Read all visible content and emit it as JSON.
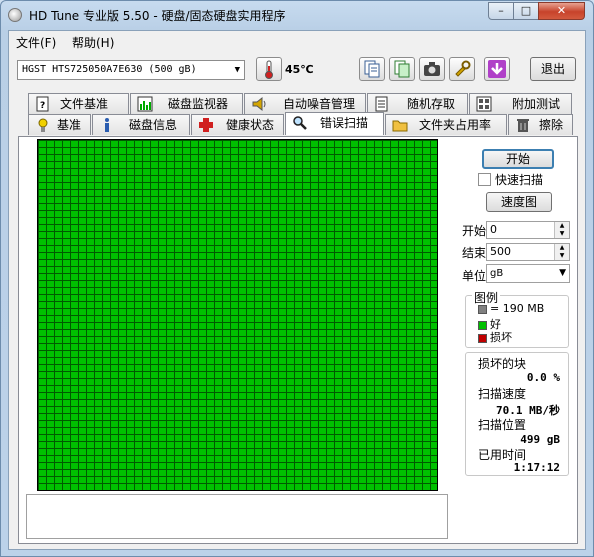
{
  "window": {
    "title": "HD Tune 专业版 5.50 - 硬盘/固态硬盘实用程序",
    "min": "–",
    "max": "□",
    "close": "✕"
  },
  "menu": {
    "file": "文件(F)",
    "help": "帮助(H)"
  },
  "toolbar": {
    "drive": "HGST   HTS725050A7E630  (500 gB)",
    "temperature": "45℃",
    "exit": "退出"
  },
  "tabs_row1": [
    {
      "label": "文件基准",
      "icon": "file-benchmark-icon"
    },
    {
      "label": "磁盘监视器",
      "icon": "disk-monitor-icon"
    },
    {
      "label": "自动噪音管理",
      "icon": "speaker-icon"
    },
    {
      "label": "随机存取",
      "icon": "random-access-icon"
    },
    {
      "label": "附加测试",
      "icon": "extra-tests-icon"
    }
  ],
  "tabs_row2": [
    {
      "label": "基准",
      "icon": "benchmark-icon"
    },
    {
      "label": "磁盘信息",
      "icon": "info-icon"
    },
    {
      "label": "健康状态",
      "icon": "health-cross-icon"
    },
    {
      "label": "错误扫描",
      "icon": "magnifier-icon"
    },
    {
      "label": "文件夹占用率",
      "icon": "folder-icon"
    },
    {
      "label": "擦除",
      "icon": "trash-icon"
    }
  ],
  "controls": {
    "start_button": "开始",
    "quick_scan": "快速扫描",
    "map_button": "速度图",
    "start_label": "开始",
    "start_value": "0",
    "end_label": "结束",
    "end_value": "500",
    "unit_label": "单位",
    "unit_value": "gB"
  },
  "legend": {
    "title": "图例",
    "block_size": "= 190 MB",
    "good": "好",
    "damaged": "损坏"
  },
  "stats": {
    "damaged_blocks_label": "损坏的块",
    "damaged_blocks_value": "0.0 %",
    "scan_speed_label": "扫描速度",
    "scan_speed_value": "70.1 MB/秒",
    "scan_position_label": "扫描位置",
    "scan_position_value": "499 gB",
    "elapsed_label": "已用时间",
    "elapsed_value": "1:17:12"
  },
  "colors": {
    "good": "#00c000",
    "damaged": "#c00000",
    "block": "#808080"
  }
}
